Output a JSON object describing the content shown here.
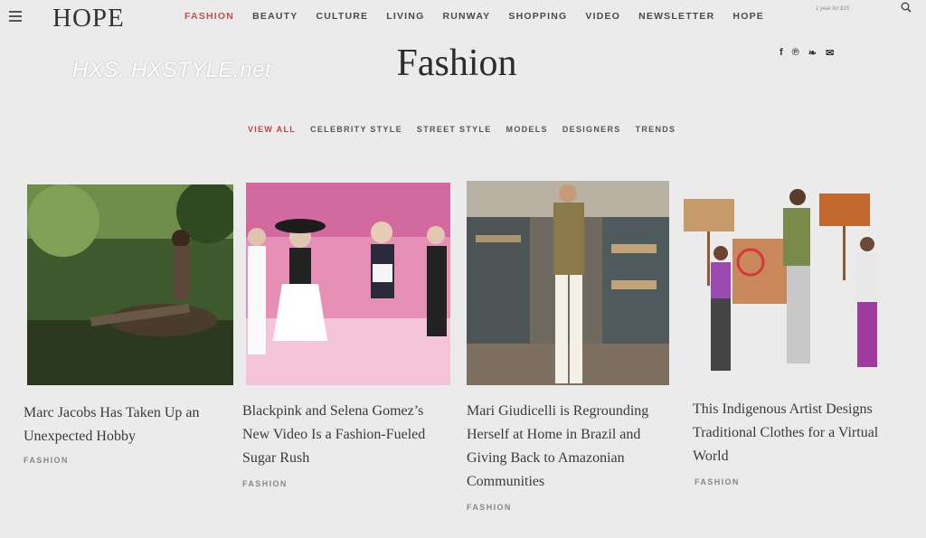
{
  "header": {
    "logo": "HOPE",
    "nav": [
      "FASHION",
      "BEAUTY",
      "CULTURE",
      "LIVING",
      "RUNWAY",
      "SHOPPING",
      "VIDEO",
      "NEWSLETTER",
      "HOPE"
    ],
    "active_nav": "FASHION",
    "tagline": "1 year for $15"
  },
  "page": {
    "title": "Fashion",
    "watermark": "HXS. HXSTYLE.net",
    "social_icons": [
      "facebook-icon",
      "pinterest-icon",
      "twitter-icon",
      "email-icon"
    ],
    "social_glyphs": [
      "f",
      "℗",
      "❧",
      "✉"
    ]
  },
  "subnav": [
    "VIEW ALL",
    "CELEBRITY STYLE",
    "STREET STYLE",
    "MODELS",
    "DESIGNERS",
    "TRENDS"
  ],
  "cards": [
    {
      "headline": "Marc Jacobs Has Taken Up an Unexpected Hobby",
      "tag": "FASHION"
    },
    {
      "headline": "Blackpink and Selena Gomez’s New Video Is a Fashion-Fueled Sugar Rush",
      "tag": "FASHION"
    },
    {
      "headline": "Mari Giudicelli is Regrounding Herself at Home in Brazil and Giving Back to Amazonian Communities",
      "tag": "FASHION"
    },
    {
      "headline": "This Indigenous Artist Designs Traditional Clothes for a Virtual World",
      "tag": "FASHION"
    }
  ],
  "colors": {
    "accent": "#c0504d",
    "background": "#ecebec",
    "text": "#2b2b2b"
  }
}
